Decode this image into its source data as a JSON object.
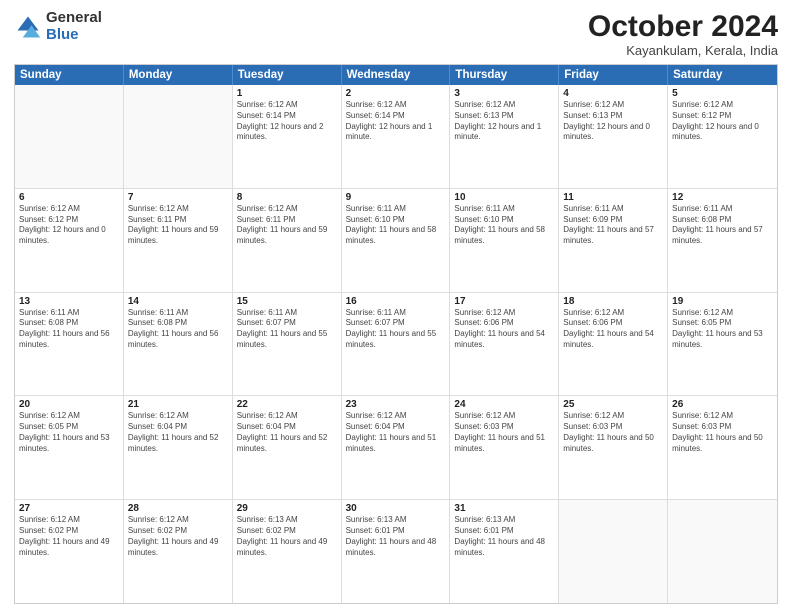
{
  "logo": {
    "general": "General",
    "blue": "Blue"
  },
  "title": {
    "month_year": "October 2024",
    "location": "Kayankulam, Kerala, India"
  },
  "weekdays": [
    "Sunday",
    "Monday",
    "Tuesday",
    "Wednesday",
    "Thursday",
    "Friday",
    "Saturday"
  ],
  "rows": [
    [
      {
        "day": "",
        "sunrise": "",
        "sunset": "",
        "daylight": ""
      },
      {
        "day": "",
        "sunrise": "",
        "sunset": "",
        "daylight": ""
      },
      {
        "day": "1",
        "sunrise": "Sunrise: 6:12 AM",
        "sunset": "Sunset: 6:14 PM",
        "daylight": "Daylight: 12 hours and 2 minutes."
      },
      {
        "day": "2",
        "sunrise": "Sunrise: 6:12 AM",
        "sunset": "Sunset: 6:14 PM",
        "daylight": "Daylight: 12 hours and 1 minute."
      },
      {
        "day": "3",
        "sunrise": "Sunrise: 6:12 AM",
        "sunset": "Sunset: 6:13 PM",
        "daylight": "Daylight: 12 hours and 1 minute."
      },
      {
        "day": "4",
        "sunrise": "Sunrise: 6:12 AM",
        "sunset": "Sunset: 6:13 PM",
        "daylight": "Daylight: 12 hours and 0 minutes."
      },
      {
        "day": "5",
        "sunrise": "Sunrise: 6:12 AM",
        "sunset": "Sunset: 6:12 PM",
        "daylight": "Daylight: 12 hours and 0 minutes."
      }
    ],
    [
      {
        "day": "6",
        "sunrise": "Sunrise: 6:12 AM",
        "sunset": "Sunset: 6:12 PM",
        "daylight": "Daylight: 12 hours and 0 minutes."
      },
      {
        "day": "7",
        "sunrise": "Sunrise: 6:12 AM",
        "sunset": "Sunset: 6:11 PM",
        "daylight": "Daylight: 11 hours and 59 minutes."
      },
      {
        "day": "8",
        "sunrise": "Sunrise: 6:12 AM",
        "sunset": "Sunset: 6:11 PM",
        "daylight": "Daylight: 11 hours and 59 minutes."
      },
      {
        "day": "9",
        "sunrise": "Sunrise: 6:11 AM",
        "sunset": "Sunset: 6:10 PM",
        "daylight": "Daylight: 11 hours and 58 minutes."
      },
      {
        "day": "10",
        "sunrise": "Sunrise: 6:11 AM",
        "sunset": "Sunset: 6:10 PM",
        "daylight": "Daylight: 11 hours and 58 minutes."
      },
      {
        "day": "11",
        "sunrise": "Sunrise: 6:11 AM",
        "sunset": "Sunset: 6:09 PM",
        "daylight": "Daylight: 11 hours and 57 minutes."
      },
      {
        "day": "12",
        "sunrise": "Sunrise: 6:11 AM",
        "sunset": "Sunset: 6:08 PM",
        "daylight": "Daylight: 11 hours and 57 minutes."
      }
    ],
    [
      {
        "day": "13",
        "sunrise": "Sunrise: 6:11 AM",
        "sunset": "Sunset: 6:08 PM",
        "daylight": "Daylight: 11 hours and 56 minutes."
      },
      {
        "day": "14",
        "sunrise": "Sunrise: 6:11 AM",
        "sunset": "Sunset: 6:08 PM",
        "daylight": "Daylight: 11 hours and 56 minutes."
      },
      {
        "day": "15",
        "sunrise": "Sunrise: 6:11 AM",
        "sunset": "Sunset: 6:07 PM",
        "daylight": "Daylight: 11 hours and 55 minutes."
      },
      {
        "day": "16",
        "sunrise": "Sunrise: 6:11 AM",
        "sunset": "Sunset: 6:07 PM",
        "daylight": "Daylight: 11 hours and 55 minutes."
      },
      {
        "day": "17",
        "sunrise": "Sunrise: 6:12 AM",
        "sunset": "Sunset: 6:06 PM",
        "daylight": "Daylight: 11 hours and 54 minutes."
      },
      {
        "day": "18",
        "sunrise": "Sunrise: 6:12 AM",
        "sunset": "Sunset: 6:06 PM",
        "daylight": "Daylight: 11 hours and 54 minutes."
      },
      {
        "day": "19",
        "sunrise": "Sunrise: 6:12 AM",
        "sunset": "Sunset: 6:05 PM",
        "daylight": "Daylight: 11 hours and 53 minutes."
      }
    ],
    [
      {
        "day": "20",
        "sunrise": "Sunrise: 6:12 AM",
        "sunset": "Sunset: 6:05 PM",
        "daylight": "Daylight: 11 hours and 53 minutes."
      },
      {
        "day": "21",
        "sunrise": "Sunrise: 6:12 AM",
        "sunset": "Sunset: 6:04 PM",
        "daylight": "Daylight: 11 hours and 52 minutes."
      },
      {
        "day": "22",
        "sunrise": "Sunrise: 6:12 AM",
        "sunset": "Sunset: 6:04 PM",
        "daylight": "Daylight: 11 hours and 52 minutes."
      },
      {
        "day": "23",
        "sunrise": "Sunrise: 6:12 AM",
        "sunset": "Sunset: 6:04 PM",
        "daylight": "Daylight: 11 hours and 51 minutes."
      },
      {
        "day": "24",
        "sunrise": "Sunrise: 6:12 AM",
        "sunset": "Sunset: 6:03 PM",
        "daylight": "Daylight: 11 hours and 51 minutes."
      },
      {
        "day": "25",
        "sunrise": "Sunrise: 6:12 AM",
        "sunset": "Sunset: 6:03 PM",
        "daylight": "Daylight: 11 hours and 50 minutes."
      },
      {
        "day": "26",
        "sunrise": "Sunrise: 6:12 AM",
        "sunset": "Sunset: 6:03 PM",
        "daylight": "Daylight: 11 hours and 50 minutes."
      }
    ],
    [
      {
        "day": "27",
        "sunrise": "Sunrise: 6:12 AM",
        "sunset": "Sunset: 6:02 PM",
        "daylight": "Daylight: 11 hours and 49 minutes."
      },
      {
        "day": "28",
        "sunrise": "Sunrise: 6:12 AM",
        "sunset": "Sunset: 6:02 PM",
        "daylight": "Daylight: 11 hours and 49 minutes."
      },
      {
        "day": "29",
        "sunrise": "Sunrise: 6:13 AM",
        "sunset": "Sunset: 6:02 PM",
        "daylight": "Daylight: 11 hours and 49 minutes."
      },
      {
        "day": "30",
        "sunrise": "Sunrise: 6:13 AM",
        "sunset": "Sunset: 6:01 PM",
        "daylight": "Daylight: 11 hours and 48 minutes."
      },
      {
        "day": "31",
        "sunrise": "Sunrise: 6:13 AM",
        "sunset": "Sunset: 6:01 PM",
        "daylight": "Daylight: 11 hours and 48 minutes."
      },
      {
        "day": "",
        "sunrise": "",
        "sunset": "",
        "daylight": ""
      },
      {
        "day": "",
        "sunrise": "",
        "sunset": "",
        "daylight": ""
      }
    ]
  ]
}
